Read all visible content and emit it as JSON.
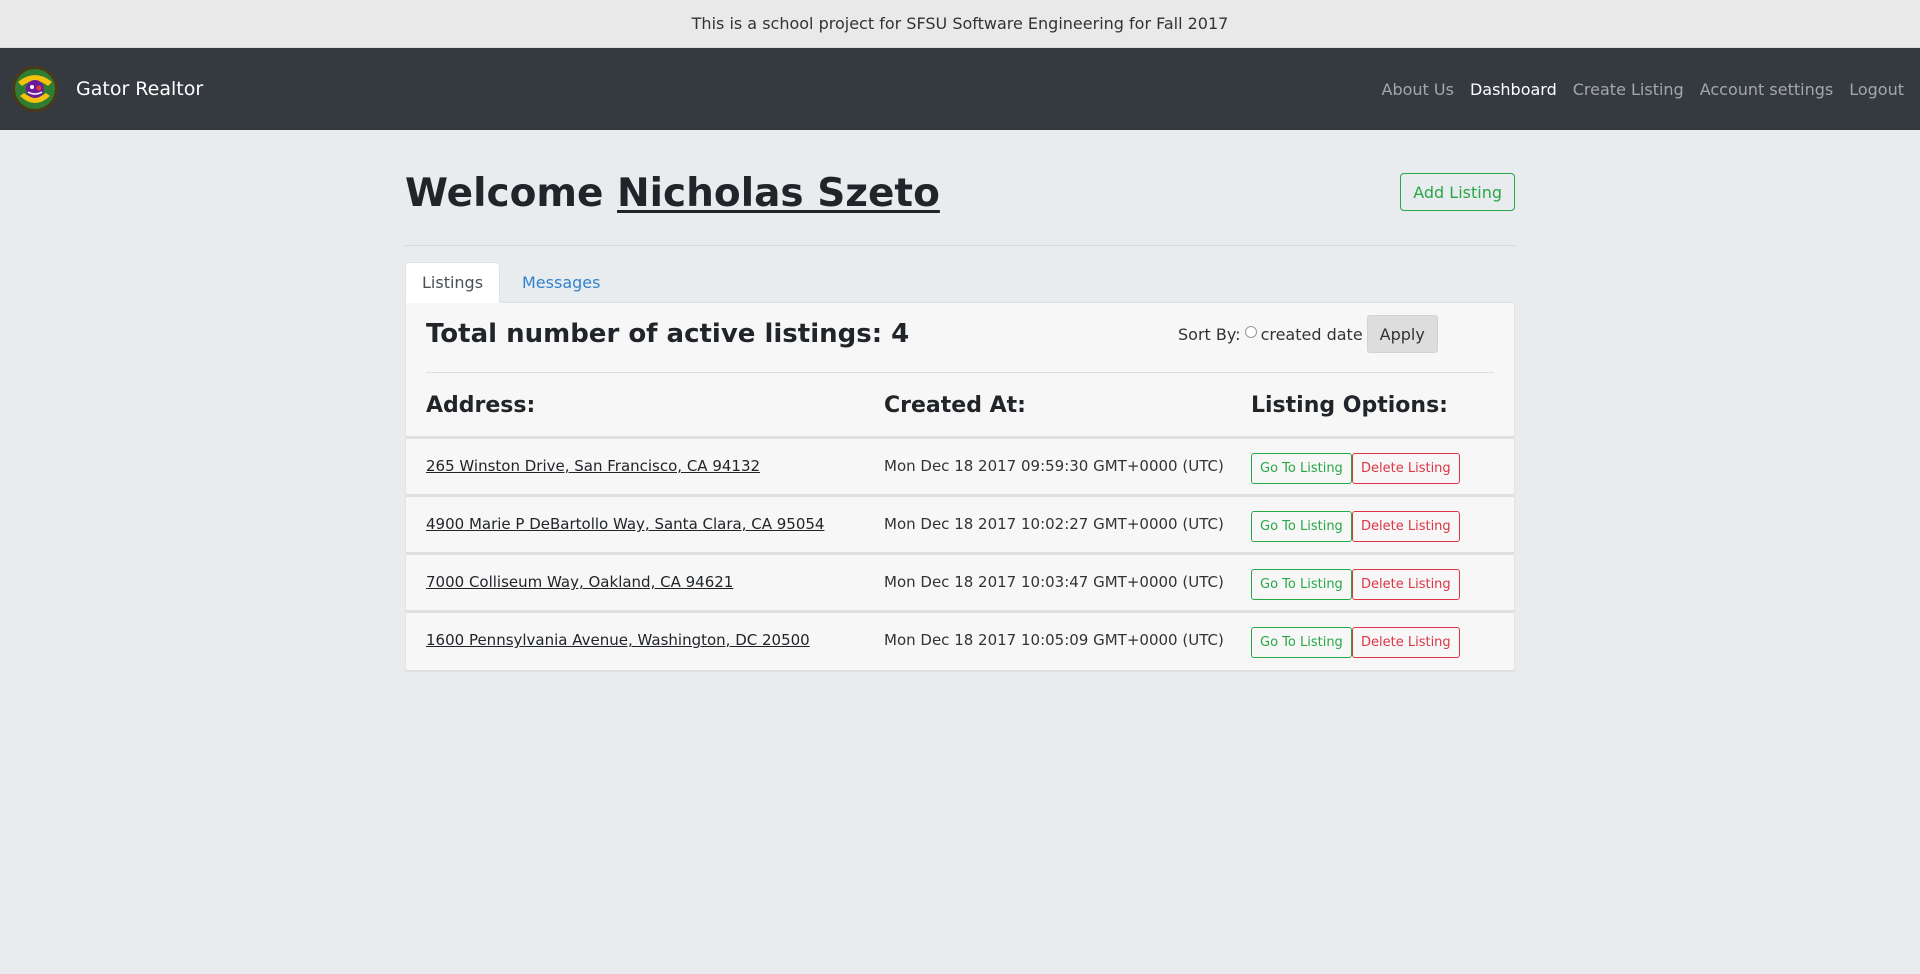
{
  "banner": {
    "text": "This is a school project for SFSU Software Engineering for Fall 2017"
  },
  "navbar": {
    "brand": "Gator Realtor",
    "links": [
      {
        "label": "About Us",
        "active": false
      },
      {
        "label": "Dashboard",
        "active": true
      },
      {
        "label": "Create Listing",
        "active": false
      },
      {
        "label": "Account settings",
        "active": false
      },
      {
        "label": "Logout",
        "active": false
      }
    ]
  },
  "welcome": {
    "prefix": "Welcome",
    "user": "Nicholas Szeto"
  },
  "add_listing_label": "Add Listing",
  "tabs": [
    {
      "label": "Listings",
      "active": true
    },
    {
      "label": "Messages",
      "active": false
    }
  ],
  "listings": {
    "total_text": "Total number of active listings: 4",
    "sort_label": "Sort By:",
    "sort_option": "created date",
    "apply_label": "Apply",
    "headers": {
      "address": "Address:",
      "created": "Created At:",
      "options": "Listing Options:"
    },
    "rows": [
      {
        "address": "265 Winston Drive, San Francisco, CA 94132",
        "created": "Mon Dec 18 2017 09:59:30 GMT+0000 (UTC)"
      },
      {
        "address": "4900 Marie P DeBartollo Way, Santa Clara, CA 95054",
        "created": "Mon Dec 18 2017 10:02:27 GMT+0000 (UTC)"
      },
      {
        "address": "7000 Colliseum Way, Oakland, CA 94621",
        "created": "Mon Dec 18 2017 10:03:47 GMT+0000 (UTC)"
      },
      {
        "address": "1600 Pennsylvania Avenue, Washington, DC 20500",
        "created": "Mon Dec 18 2017 10:05:09 GMT+0000 (UTC)"
      }
    ],
    "go_label": "Go To Listing",
    "delete_label": "Delete Listing"
  },
  "colors": {
    "success": "#28a745",
    "danger": "#dc3545",
    "navbar": "#343a40",
    "link": "#3182ce"
  }
}
